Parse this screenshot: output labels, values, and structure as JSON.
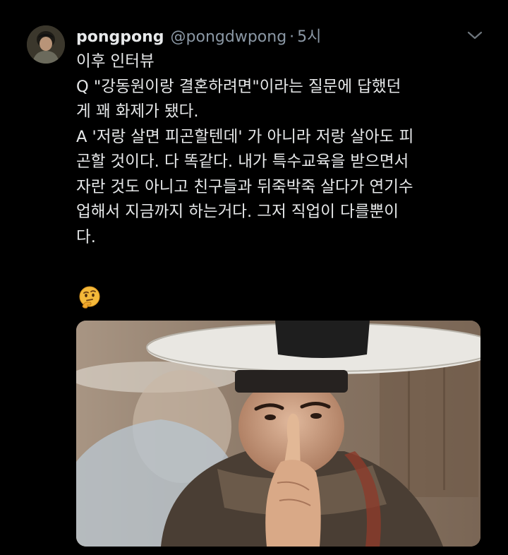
{
  "tweet": {
    "author": {
      "display_name": "pongpong",
      "handle": "@pongdwpong",
      "avatar_icon": "user-avatar"
    },
    "separator": "·",
    "timestamp": "5시",
    "menu_icon": "chevron-down-icon",
    "text_lines": [
      "이후 인터뷰",
      "Q \"강동원이랑 결혼하려면\"이라는 질문에 답했던",
      "게 꽤 화제가 됐다.",
      "A '저랑 살면 피곤할텐데' 가 아니라 저랑 살아도 피",
      "곤할 것이다. 다 똑같다. 내가 특수교육을 받으면서",
      "자란 것도 아니고 친구들과 뒤죽박죽 살다가 연기수",
      "업해서 지금까지 하는거다. 그저 직업이 다를뿐이",
      "다."
    ],
    "emoji": "thinking-face-emoji",
    "media": {
      "type": "photo",
      "description_icon": "photo-man-in-gat-shushing"
    }
  },
  "colors": {
    "background": "#000000",
    "text_primary": "#e7e9ea",
    "text_secondary": "#8b98a5"
  }
}
